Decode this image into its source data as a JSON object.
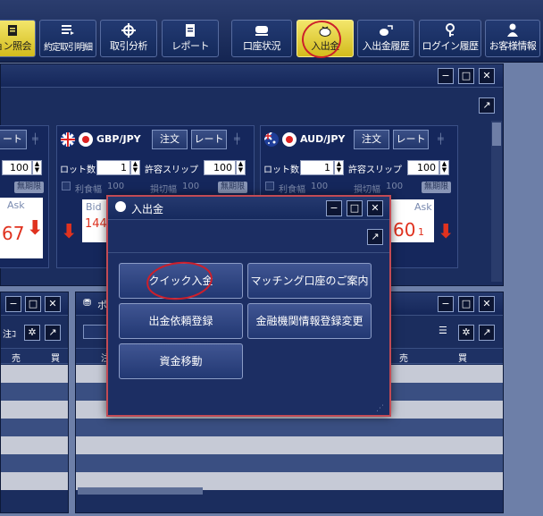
{
  "toolbar": {
    "buttons": [
      {
        "label": "ョン照会",
        "icon": "report-icon",
        "active": false
      },
      {
        "label": "約定取引明細",
        "icon": "list-icon",
        "active": false
      },
      {
        "label": "取引分析",
        "icon": "crosshair-icon",
        "active": false
      },
      {
        "label": "レポート",
        "icon": "document-icon",
        "active": false
      },
      {
        "label": "口座状況",
        "icon": "account-icon",
        "active": false
      },
      {
        "label": "入出金",
        "icon": "money-bag-icon",
        "active": true
      },
      {
        "label": "入出金履歴",
        "icon": "money-history-icon",
        "active": false
      },
      {
        "label": "ログイン履歴",
        "icon": "key-icon",
        "active": false
      },
      {
        "label": "お客様情報",
        "icon": "person-icon",
        "active": false
      }
    ]
  },
  "rate_panel": {
    "left_partial": {
      "rate_label": "ート",
      "lot": "100",
      "badge": "無期限",
      "ask_label": "Ask",
      "ask_value": "67"
    },
    "pairs": [
      {
        "pair": "GBP/JPY",
        "order_label": "注文",
        "rate_label": "レート",
        "lot_label": "ロット数",
        "lot_value": "1",
        "slip_label": "許容スリップ",
        "slip_value": "100",
        "profit_label": "利食幅",
        "profit_value": "100",
        "loss_label": "損切幅",
        "loss_value": "100",
        "badge": "無期限",
        "bid_label": "Bid",
        "bid_value": "144"
      },
      {
        "pair": "AUD/JPY",
        "order_label": "注文",
        "rate_label": "レート",
        "lot_label": "ロット数",
        "lot_value": "1",
        "slip_label": "許容スリップ",
        "slip_value": "100",
        "profit_label": "利食幅",
        "profit_value": "100",
        "loss_label": "損切幅",
        "loss_value": "100",
        "badge": "無期限",
        "ask_label": "Ask",
        "ask_value": "60",
        "ask_small": "1"
      }
    ]
  },
  "bottom_left": {
    "order_label": "注ｺ",
    "col_sell": "売",
    "col_buy": "買"
  },
  "bottom_right": {
    "title": "ポ",
    "col_sell": "売",
    "col_buy": "買",
    "col_mid": "注"
  },
  "dialog": {
    "title": "入出金",
    "buttons": [
      {
        "label": "クイック入金"
      },
      {
        "label": "マッチング口座のご案内"
      },
      {
        "label": "出金依頼登録"
      },
      {
        "label": "金融機関情報登録変更"
      },
      {
        "label": "資金移動"
      }
    ]
  },
  "window_controls": {
    "minimize": "−",
    "maximize": "□",
    "close": "✕",
    "popout": "↗"
  },
  "annotation_color": "#cc1f2b"
}
